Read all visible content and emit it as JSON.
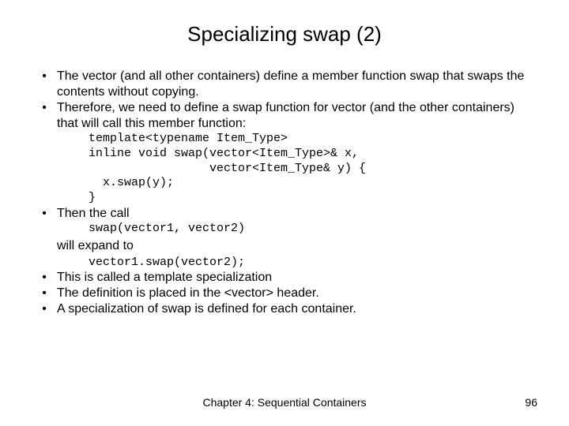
{
  "title": "Specializing swap (2)",
  "bullets": {
    "b1": "The vector (and all other containers) define a member function swap that swaps the contents without copying.",
    "b2": "Therefore, we need to define a swap function for vector (and the other containers) that will call this member function:",
    "b3": "Then the call",
    "b3cont": "will expand to",
    "b4": "This is called a template specialization",
    "b5": "The definition is placed in the <vector> header.",
    "b6": "A specialization of swap is defined for each container."
  },
  "code": {
    "block1": "template<typename Item_Type>\ninline void swap(vector<Item_Type>& x,\n                 vector<Item_Type& y) {\n  x.swap(y);\n}",
    "block2": "swap(vector1, vector2)",
    "block3": "vector1.swap(vector2);"
  },
  "footer": {
    "chapter": "Chapter 4: Sequential Containers",
    "page": "96"
  },
  "dot": "•"
}
